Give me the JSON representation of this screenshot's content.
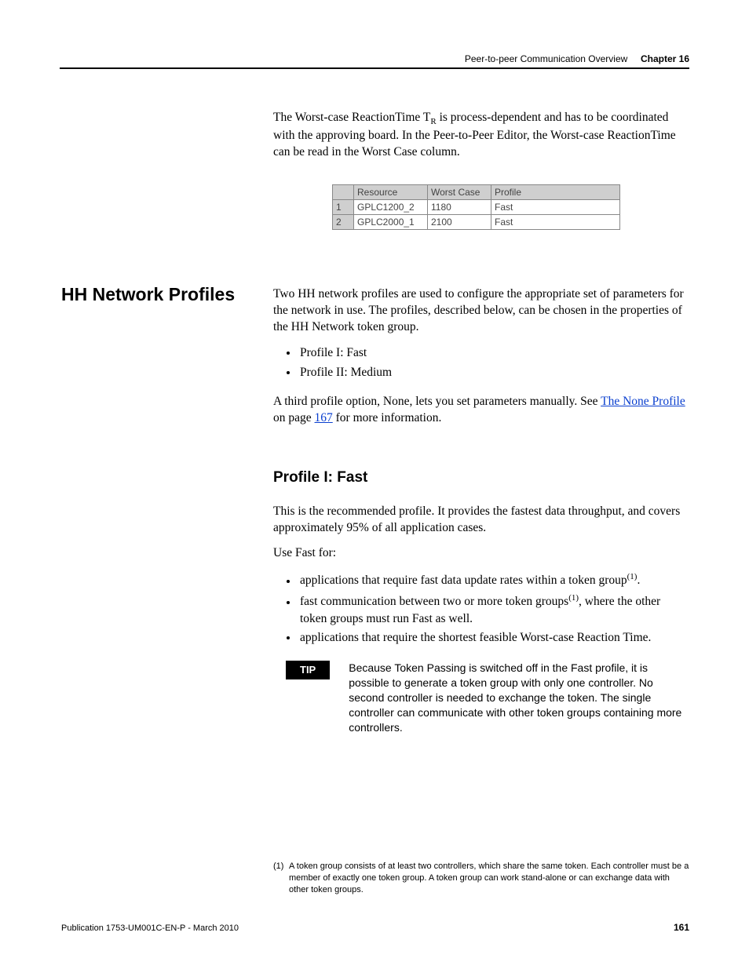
{
  "header": {
    "section": "Peer-to-peer Communication Overview",
    "chapter": "Chapter 16"
  },
  "intro_para": "The Worst-case ReactionTime T",
  "intro_sub": "R",
  "intro_para_cont": " is process-dependent and has to be coordinated with the approving board. In the Peer-to-Peer Editor, the Worst-case ReactionTime can be read in the Worst Case column.",
  "table": {
    "headers": {
      "h0": "",
      "h1": "Resource",
      "h2": "Worst Case",
      "h3": "Profile"
    },
    "rows": [
      {
        "n": "1",
        "resource": "GPLC1200_2",
        "worst": "1180",
        "profile": "Fast"
      },
      {
        "n": "2",
        "resource": "GPLC2000_1",
        "worst": "2100",
        "profile": "Fast"
      }
    ]
  },
  "side_heading": "HH Network Profiles",
  "hh_intro": "Two HH network profiles are used to configure the appropriate set of parameters for the network in use. The profiles, described below, can be chosen in the properties of the HH Network token group.",
  "hh_bullets": {
    "b1": "Profile I: Fast",
    "b2": "Profile II: Medium"
  },
  "hh_third_pre": "A third profile option, None, lets you set parameters manually. See ",
  "hh_link": "The None Profile",
  "hh_third_mid": " on page ",
  "hh_page": "167",
  "hh_third_post": " for more information.",
  "profile": {
    "title": "Profile I: Fast",
    "p1": "This is the recommended profile. It provides the fastest data throughput, and covers approximately 95% of all application cases.",
    "p2": "Use Fast for:",
    "bullets": {
      "b1a": "applications that require fast data update rates within a token group",
      "b1b": ".",
      "b2a": "fast communication between two or more token groups",
      "b2b": ", where the other token groups must run Fast as well.",
      "b3": "applications that require the shortest feasible Worst-case Reaction Time."
    },
    "sup1": "(1)",
    "tip_label": "TIP",
    "tip_text": "Because Token Passing is switched off in the Fast profile, it is possible to generate a token group with only one controller. No second controller is needed to exchange the token. The single controller can communicate with other token groups containing more controllers."
  },
  "footnote": {
    "num": "(1)",
    "text": "A token group consists of at least two controllers, which share the same token. Each controller must be a member of exactly one token group. A token group can work stand-alone or can exchange data with other token groups."
  },
  "footer": {
    "left": "Publication 1753-UM001C-EN-P - March 2010",
    "right": "161"
  }
}
